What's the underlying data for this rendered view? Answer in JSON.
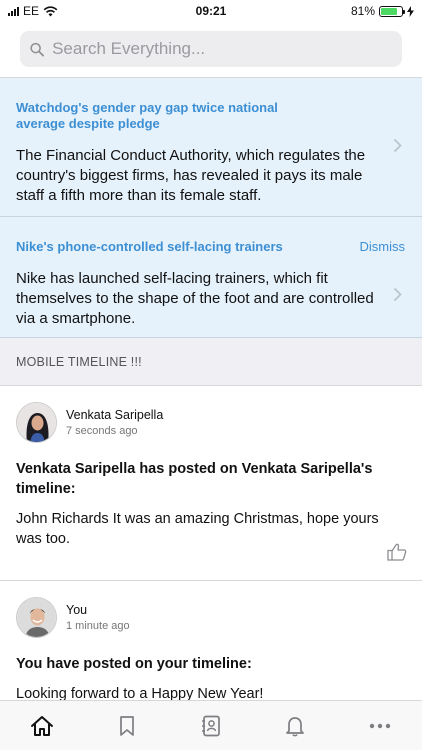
{
  "status_bar": {
    "carrier": "EE",
    "time": "09:21",
    "battery": "81%",
    "battery_level": 0.81
  },
  "search": {
    "placeholder": "Search Everything..."
  },
  "news": [
    {
      "title": "Watchdog's gender pay gap twice national average despite pledge",
      "body": "The Financial Conduct Authority, which regulates the country's biggest firms, has revealed it pays its male staff a fifth more than its female staff."
    },
    {
      "title": "Nike's phone-controlled self-lacing trainers",
      "dismiss": "Dismiss",
      "body": "Nike has launched self-lacing trainers, which fit themselves to the shape of the foot and are controlled via a smartphone."
    }
  ],
  "timeline": {
    "header": "MOBILE TIMELINE !!!",
    "posts": [
      {
        "author": "Venkata Saripella",
        "time": "7 seconds ago",
        "title": "Venkata Saripella has posted on Venkata Saripella's timeline:",
        "body": "John Richards It was an amazing Christmas, hope yours was too."
      },
      {
        "author": "You",
        "time": "1 minute ago",
        "title": "You have posted on your timeline:",
        "body": "Looking forward to a Happy New Year!"
      }
    ]
  },
  "tabs": [
    {
      "icon": "home-icon",
      "active": true
    },
    {
      "icon": "bookmark-icon",
      "active": false
    },
    {
      "icon": "contacts-icon",
      "active": false
    },
    {
      "icon": "bell-icon",
      "active": false
    },
    {
      "icon": "more-icon",
      "active": false
    }
  ],
  "colors": {
    "accent": "#3d8fd4",
    "card_bg": "#e6f2fb",
    "section_bg": "#efeff4",
    "battery": "#4cd964"
  }
}
